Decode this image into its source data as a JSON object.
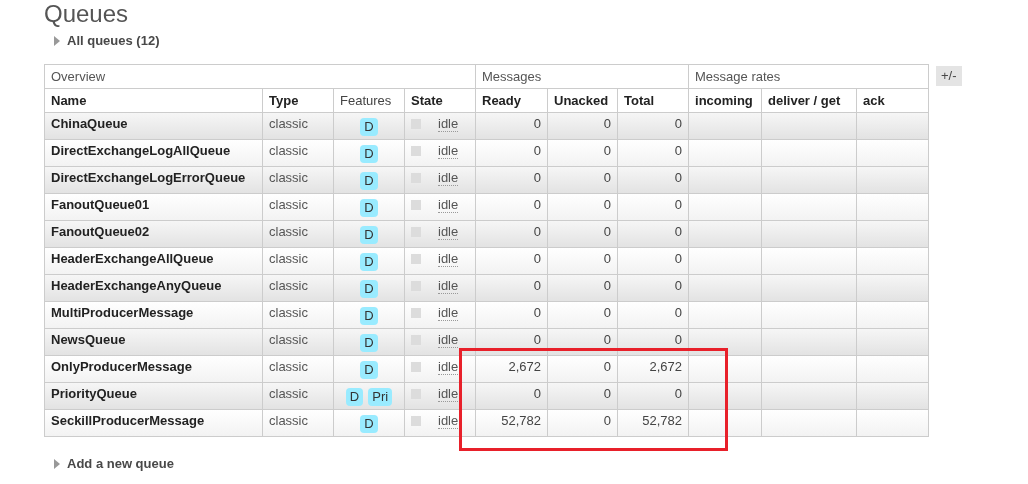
{
  "page_title": "Queues",
  "all_queues": "All queues (12)",
  "group_headers": [
    "Overview",
    "Messages",
    "Message rates"
  ],
  "columns": [
    "Name",
    "Type",
    "Features",
    "State",
    "Ready",
    "Unacked",
    "Total",
    "incoming",
    "deliver / get",
    "ack"
  ],
  "toggle_columns": "+/-",
  "rows": [
    {
      "name": "ChinaQueue",
      "type": "classic",
      "features": [
        "D"
      ],
      "state": "idle",
      "ready": "0",
      "unacked": "0",
      "total": "0"
    },
    {
      "name": "DirectExchangeLogAllQueue",
      "type": "classic",
      "features": [
        "D"
      ],
      "state": "idle",
      "ready": "0",
      "unacked": "0",
      "total": "0"
    },
    {
      "name": "DirectExchangeLogErrorQueue",
      "type": "classic",
      "features": [
        "D"
      ],
      "state": "idle",
      "ready": "0",
      "unacked": "0",
      "total": "0"
    },
    {
      "name": "FanoutQueue01",
      "type": "classic",
      "features": [
        "D"
      ],
      "state": "idle",
      "ready": "0",
      "unacked": "0",
      "total": "0"
    },
    {
      "name": "FanoutQueue02",
      "type": "classic",
      "features": [
        "D"
      ],
      "state": "idle",
      "ready": "0",
      "unacked": "0",
      "total": "0"
    },
    {
      "name": "HeaderExchangeAllQueue",
      "type": "classic",
      "features": [
        "D"
      ],
      "state": "idle",
      "ready": "0",
      "unacked": "0",
      "total": "0"
    },
    {
      "name": "HeaderExchangeAnyQueue",
      "type": "classic",
      "features": [
        "D"
      ],
      "state": "idle",
      "ready": "0",
      "unacked": "0",
      "total": "0"
    },
    {
      "name": "MultiProducerMessage",
      "type": "classic",
      "features": [
        "D"
      ],
      "state": "idle",
      "ready": "0",
      "unacked": "0",
      "total": "0"
    },
    {
      "name": "NewsQueue",
      "type": "classic",
      "features": [
        "D"
      ],
      "state": "idle",
      "ready": "0",
      "unacked": "0",
      "total": "0"
    },
    {
      "name": "OnlyProducerMessage",
      "type": "classic",
      "features": [
        "D"
      ],
      "state": "idle",
      "ready": "2,672",
      "unacked": "0",
      "total": "2,672"
    },
    {
      "name": "PriorityQueue",
      "type": "classic",
      "features": [
        "D",
        "Pri"
      ],
      "state": "idle",
      "ready": "0",
      "unacked": "0",
      "total": "0"
    },
    {
      "name": "SeckillProducerMessage",
      "type": "classic",
      "features": [
        "D"
      ],
      "state": "idle",
      "ready": "52,782",
      "unacked": "0",
      "total": "52,782"
    }
  ],
  "add_queue": "Add a new queue"
}
